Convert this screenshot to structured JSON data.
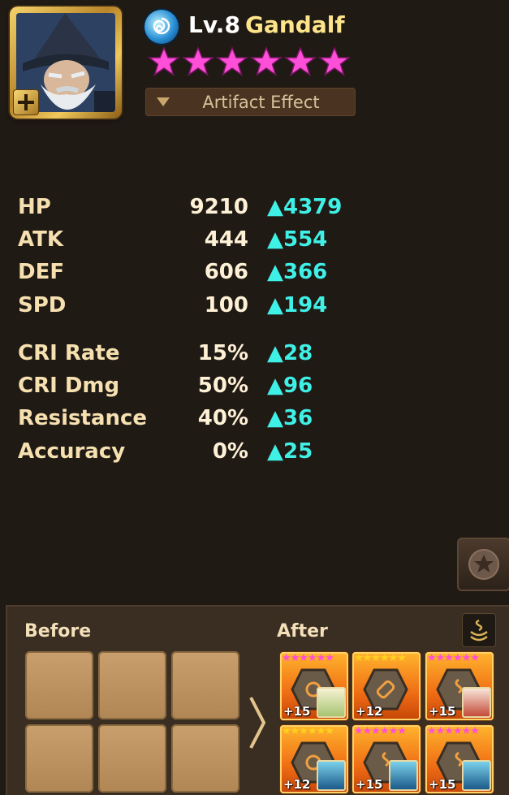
{
  "monster": {
    "level": "Lv.8",
    "name": "Gandalf",
    "element_icon": "water-element-icon",
    "star_count": 6,
    "star_color": "#ff4fd8",
    "artifact_button_label": "Artifact Effect"
  },
  "stats_primary": [
    {
      "label": "HP",
      "value": "9210",
      "bonus": "▲4379"
    },
    {
      "label": "ATK",
      "value": "444",
      "bonus": "▲554"
    },
    {
      "label": "DEF",
      "value": "606",
      "bonus": "▲366"
    },
    {
      "label": "SPD",
      "value": "100",
      "bonus": "▲194"
    }
  ],
  "stats_secondary": [
    {
      "label": "CRI Rate",
      "value": "15%",
      "bonus": "▲28"
    },
    {
      "label": "CRI Dmg",
      "value": "50%",
      "bonus": "▲96"
    },
    {
      "label": "Resistance",
      "value": "40%",
      "bonus": "▲36"
    },
    {
      "label": "Accuracy",
      "value": "0%",
      "bonus": "▲25"
    }
  ],
  "bonus_color": "#3ff0e6",
  "rune_compare": {
    "before_label": "Before",
    "after_label": "After",
    "after_runes": [
      {
        "upgrade": "+15",
        "stars_color": "#ff4fd8"
      },
      {
        "upgrade": "+12",
        "stars_color": "#ffd21f"
      },
      {
        "upgrade": "+15",
        "stars_color": "#ff4fd8"
      },
      {
        "upgrade": "+12",
        "stars_color": "#ffd21f"
      },
      {
        "upgrade": "+15",
        "stars_color": "#ff4fd8"
      },
      {
        "upgrade": "+15",
        "stars_color": "#ff4fd8"
      }
    ]
  }
}
